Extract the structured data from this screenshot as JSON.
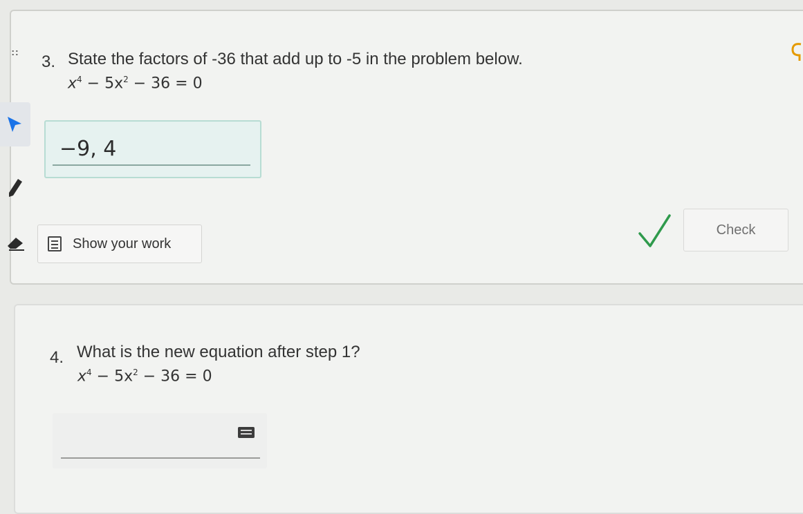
{
  "question3": {
    "number": "3.",
    "text": "State the factors of -36 that add up to -5 in the problem below.",
    "equation": {
      "a": "x",
      "e1": "4",
      "b": " − 5x",
      "e2": "2",
      "c": " − 36 = 0"
    },
    "answer_value": "−9, 4",
    "show_work_label": "Show your work",
    "check_label": "Check",
    "status": "correct"
  },
  "question4": {
    "number": "4.",
    "text": "What is the new equation after step 1?",
    "equation": {
      "a": "x",
      "e1": "4",
      "b": " − 5x",
      "e2": "2",
      "c": " − 36 = 0"
    },
    "answer_value": ""
  },
  "toolbar": {
    "drag_handle_glyph": "::",
    "icons": [
      "pointer-icon",
      "pen-icon",
      "eraser-icon"
    ]
  },
  "colors": {
    "accent": "#1a73e8",
    "correct": "#2f9a4c",
    "answer_bg": "#e6f2f0"
  }
}
